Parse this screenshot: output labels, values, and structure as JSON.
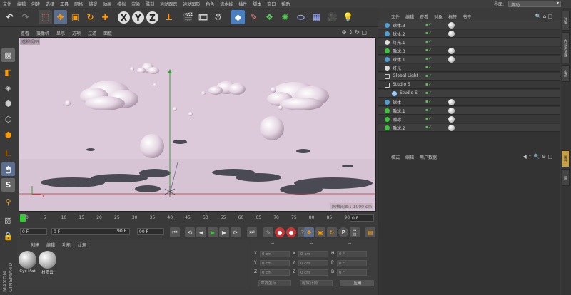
{
  "menu": [
    "文件",
    "编辑",
    "创建",
    "选择",
    "工具",
    "网格",
    "捕捉",
    "动画",
    "模拟",
    "渲染",
    "雕刻",
    "运动跟踪",
    "运动图形",
    "角色",
    "流水线",
    "插件",
    "脚本",
    "窗口",
    "帮助"
  ],
  "layout": {
    "label": "界面:",
    "value": "启动"
  },
  "toolbar": {
    "x": "X",
    "y": "Y",
    "z": "Z"
  },
  "viewport": {
    "menu": [
      "查看",
      "摄像机",
      "显示",
      "选项",
      "过滤",
      "面板"
    ],
    "label": "透视视图",
    "grid_spacing": "网格间距 : 1000 cm",
    "bg_color": "#dcc9d9"
  },
  "timeline": {
    "ticks": [
      "0",
      "5",
      "10",
      "15",
      "20",
      "25",
      "30",
      "35",
      "40",
      "45",
      "50",
      "55",
      "60",
      "65",
      "70",
      "75",
      "80",
      "85",
      "90"
    ],
    "current": "0 F"
  },
  "transport": {
    "start": "0 F",
    "cur": "0 F",
    "end_a": "90 F",
    "end_b": "90 F"
  },
  "materials": {
    "tabs": [
      "创建",
      "编辑",
      "功能",
      "纹理"
    ],
    "items": [
      {
        "name": "Cyc Mat"
      },
      {
        "name": "材质云"
      }
    ]
  },
  "coords": {
    "headers": [
      "--",
      "--",
      "--"
    ],
    "rows": [
      {
        "a": "X",
        "av": "0 cm",
        "b": "X",
        "bv": "0 cm",
        "c": "H",
        "cv": "0 °"
      },
      {
        "a": "Y",
        "av": "0 cm",
        "b": "Y",
        "bv": "0 cm",
        "c": "P",
        "cv": "0 °"
      },
      {
        "a": "Z",
        "av": "0 cm",
        "b": "Z",
        "bv": "0 cm",
        "c": "B",
        "cv": "0 °"
      }
    ],
    "mode1": "世界坐标",
    "mode2": "缩放比例",
    "apply": "应用"
  },
  "objects": {
    "menu": [
      "文件",
      "编辑",
      "查看",
      "对象",
      "标签",
      "书签"
    ],
    "rows": [
      {
        "name": "球体.3",
        "indent": 0,
        "icon": "sphere"
      },
      {
        "name": "球体.2",
        "indent": 0,
        "icon": "sphere"
      },
      {
        "name": "灯光.1",
        "indent": 0,
        "icon": "light"
      },
      {
        "name": "融球.3",
        "indent": 0,
        "icon": "metaball"
      },
      {
        "name": "球体.1",
        "indent": 0,
        "icon": "sphere"
      },
      {
        "name": "灯光",
        "indent": 0,
        "icon": "light"
      },
      {
        "name": "Global Light",
        "indent": 0,
        "icon": "null"
      },
      {
        "name": "Studio S",
        "indent": 0,
        "icon": "null"
      },
      {
        "name": "Studio S",
        "indent": 1,
        "icon": "camera"
      },
      {
        "name": "球体",
        "indent": 0,
        "icon": "sphere"
      },
      {
        "name": "融球.1",
        "indent": 0,
        "icon": "metaball"
      },
      {
        "name": "融球",
        "indent": 0,
        "icon": "metaball"
      },
      {
        "name": "融球.2",
        "indent": 0,
        "icon": "metaball"
      }
    ]
  },
  "attributes": {
    "menu": [
      "模式",
      "编辑",
      "用户数据"
    ]
  },
  "right_tabs": [
    "对象",
    "内容浏览器",
    "构造",
    "属性",
    "层"
  ],
  "logo": "MAXON CINEMA4D"
}
